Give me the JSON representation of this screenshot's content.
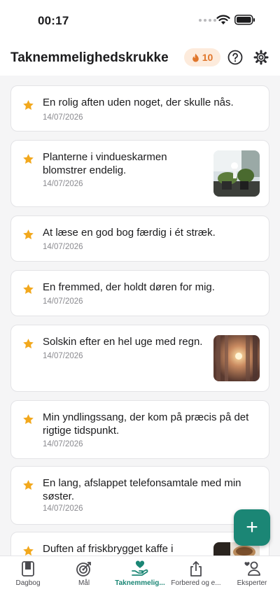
{
  "status": {
    "time": "00:17"
  },
  "header": {
    "title": "Taknemmelighedskrukke",
    "streak": "10"
  },
  "entries": [
    {
      "text": "En rolig aften uden noget, der skulle nås.",
      "date": "14/07/2026",
      "image": ""
    },
    {
      "text": "Planterne i vindueskarmen blomstrer endelig.",
      "date": "14/07/2026",
      "image": "plants-photo"
    },
    {
      "text": "At læse en god bog færdig i ét stræk.",
      "date": "14/07/2026",
      "image": ""
    },
    {
      "text": "En fremmed, der holdt døren for mig.",
      "date": "14/07/2026",
      "image": ""
    },
    {
      "text": "Solskin efter en hel uge med regn.",
      "date": "14/07/2026",
      "image": "sunset-window-photo"
    },
    {
      "text": "Min yndlingssang, der kom på præcis på det rigtige tidspunkt.",
      "date": "14/07/2026",
      "image": ""
    },
    {
      "text": "En lang, afslappet telefonsamtale med min søster.",
      "date": "14/07/2026",
      "image": ""
    },
    {
      "text": "Duften af friskbrygget kaffe i",
      "date": "",
      "image": "coffee-photo"
    }
  ],
  "fab": {
    "label": "+"
  },
  "tabs": [
    {
      "label": "Dagbog",
      "icon": "journal-icon"
    },
    {
      "label": "Mål",
      "icon": "target-icon"
    },
    {
      "label": "Taknemmelig...",
      "icon": "hand-heart-icon"
    },
    {
      "label": "Forbered og e...",
      "icon": "share-icon"
    },
    {
      "label": "Eksperter",
      "icon": "experts-icon"
    }
  ],
  "colors": {
    "accent": "#1b8675",
    "star": "#f2a81d",
    "streak": "#e0762b"
  }
}
